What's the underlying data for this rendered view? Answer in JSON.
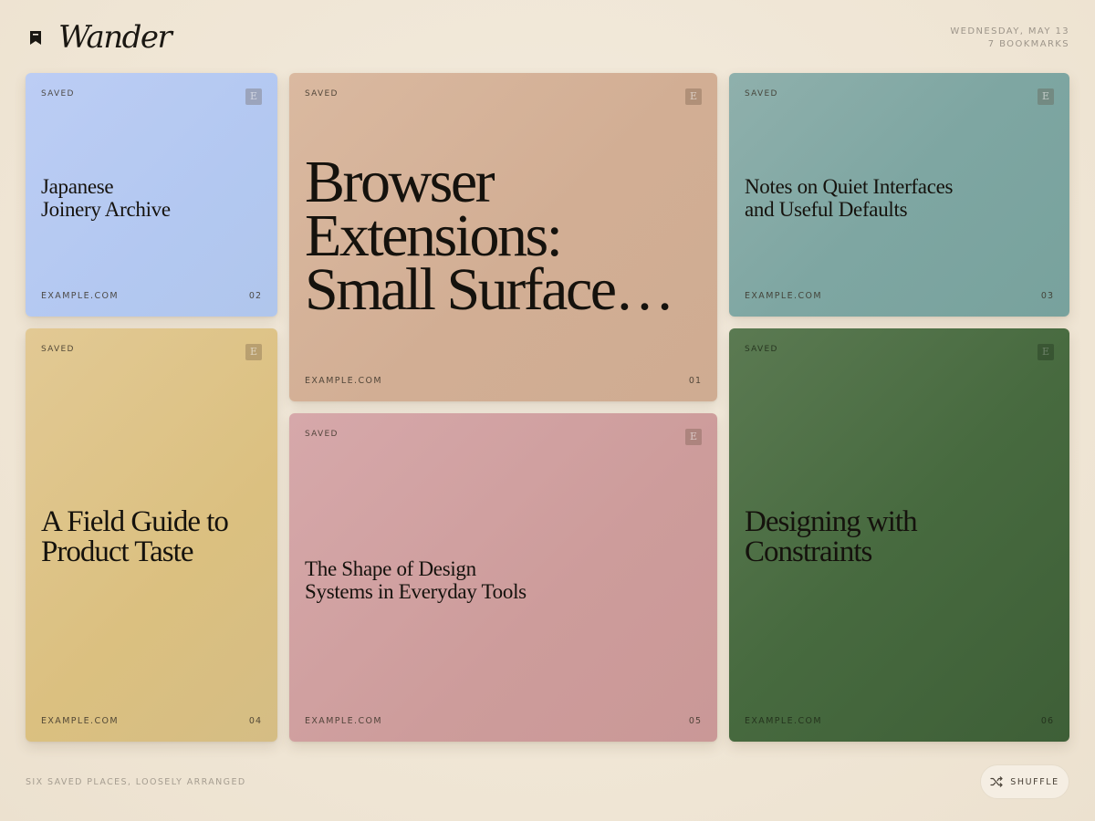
{
  "app": {
    "name": "Wander",
    "logo_icon": "bookmark-icon"
  },
  "meta": {
    "date": "WEDNESDAY, MAY 13",
    "bookmark_count": "7 BOOKMARKS"
  },
  "cards": [
    {
      "saved": "SAVED",
      "badge": "E",
      "title_lines": [
        "Japanese",
        "Joinery Archive"
      ],
      "domain": "EXAMPLE.COM",
      "number": "02",
      "color": "#b3c8f1"
    },
    {
      "saved": "SAVED",
      "badge": "E",
      "title_lines": [
        "Browser",
        "Extensions:",
        "Small Surface…"
      ],
      "domain": "EXAMPLE.COM",
      "number": "01",
      "color": "#d2ae94"
    },
    {
      "saved": "SAVED",
      "badge": "E",
      "title_lines": [
        "Notes on Quiet Interfaces",
        "and Useful Defaults"
      ],
      "domain": "EXAMPLE.COM",
      "number": "03",
      "color": "#7ea6a2"
    },
    {
      "saved": "SAVED",
      "badge": "E",
      "title_lines": [
        "A Field Guide to",
        "Product Taste"
      ],
      "domain": "EXAMPLE.COM",
      "number": "04",
      "color": "#dbc080"
    },
    {
      "saved": "SAVED",
      "badge": "E",
      "title_lines": [
        "The Shape of Design",
        "Systems in Everyday Tools"
      ],
      "domain": "EXAMPLE.COM",
      "number": "05",
      "color": "#cd9c9b"
    },
    {
      "saved": "SAVED",
      "badge": "E",
      "title_lines": [
        "Designing with",
        "Constraints"
      ],
      "domain": "EXAMPLE.COM",
      "number": "06",
      "color": "#476a3f"
    }
  ],
  "footer": {
    "caption": "SIX SAVED PLACES, LOOSELY ARRANGED",
    "shuffle_label": "SHUFFLE",
    "shuffle_icon": "shuffle-icon"
  },
  "colors": {
    "background": "#f1e8da",
    "text": "#1a1712",
    "muted": "#9d958a"
  }
}
